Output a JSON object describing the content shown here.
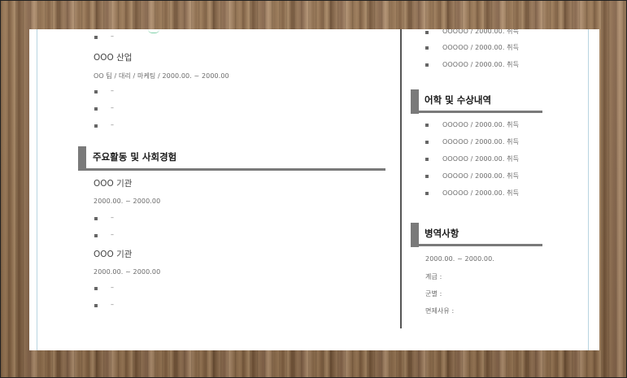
{
  "left": {
    "top_items": [
      "–"
    ],
    "company": {
      "name": "OOO 산업",
      "details": "OO 팀  /  대리  /  마케팅  / 2000.00. ~ 2000.00",
      "items": [
        "–",
        "–",
        "–"
      ]
    },
    "activities": {
      "title": "주요활동 및 사회경험",
      "entries": [
        {
          "name": "OOO 기관",
          "period": "2000.00. ~ 2000.00",
          "items": [
            "–",
            "–"
          ]
        },
        {
          "name": "OOO 기관",
          "period": "2000.00. ~ 2000.00",
          "items": [
            "–",
            "–"
          ]
        }
      ]
    }
  },
  "right": {
    "certificates": [
      "OOOOO / 2000.00. 취득",
      "OOOOO / 2000.00. 취득",
      "OOOOO / 2000.00. 취득"
    ],
    "awards": {
      "title": "어학 및 수상내역",
      "items": [
        "OOOOO / 2000.00. 취득",
        "OOOOO / 2000.00. 취득",
        "OOOOO / 2000.00. 취득",
        "OOOOO / 2000.00. 취득",
        "OOOOO / 2000.00. 취득"
      ]
    },
    "military": {
      "title": "병역사항",
      "period": "2000.00. ~ 2000.00.",
      "rank": "계급 :",
      "branch": "군별 :",
      "exemption": "면제사유 :"
    }
  }
}
